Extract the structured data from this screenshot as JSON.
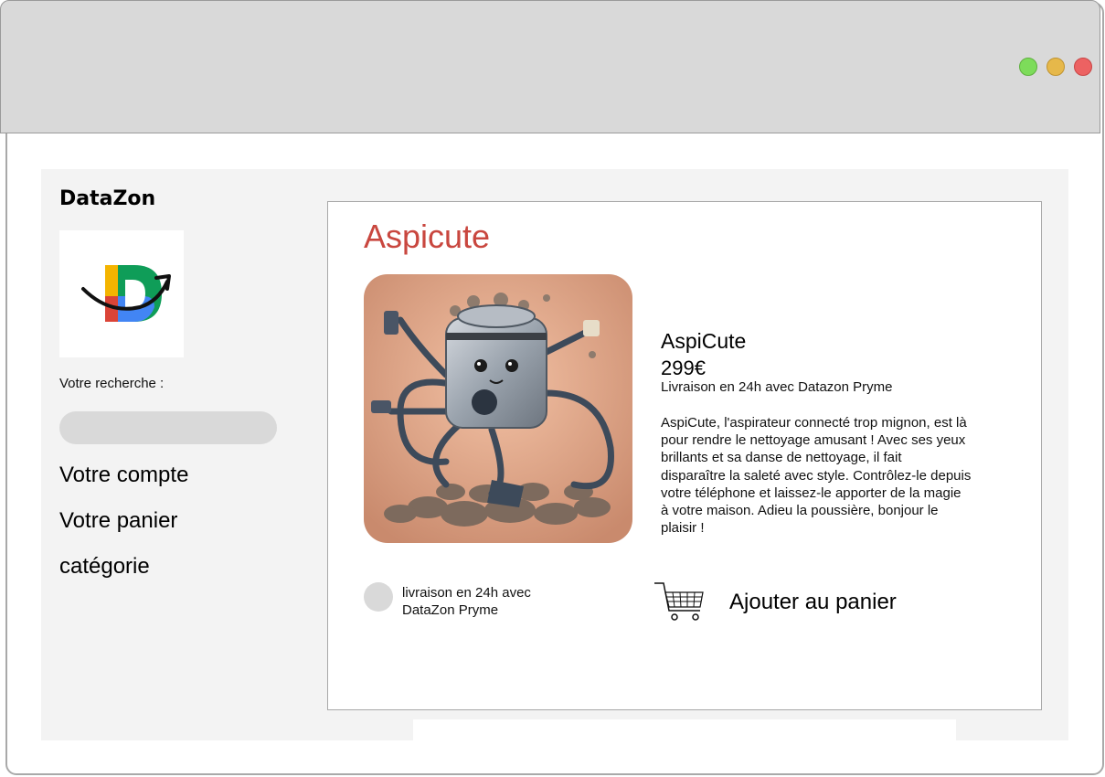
{
  "window": {
    "controls": [
      {
        "name": "maximize",
        "color": "#7ddc5a"
      },
      {
        "name": "minimize",
        "color": "#e6b84a"
      },
      {
        "name": "close",
        "color": "#ec6262"
      }
    ]
  },
  "sidebar": {
    "brand": "DataZon",
    "logo": "datazon-logo",
    "search": {
      "label": "Votre recherche :",
      "value": "",
      "placeholder": ""
    },
    "nav": [
      {
        "label": "Votre compte"
      },
      {
        "label": "Votre panier"
      },
      {
        "label": "catégorie"
      }
    ]
  },
  "product": {
    "heading": "Aspicute",
    "image": "robot-vacuum-illustration",
    "name": "AspiCute",
    "price": "299€",
    "delivery": "Livraison en 24h avec Datazon Pryme",
    "description": "AspiCute, l'aspirateur connecté trop mignon, est là\npour rendre le  nettoyage amusant ! Avec ses yeux\nbrillants et sa danse de nettoyage, il  fait\ndisparaître la saleté avec style. Contrôlez-le depuis\nvotre  téléphone et laissez-le apporter de la magie\nà votre maison.  Adieu la poussière, bonjour le\nplaisir !"
  },
  "options": {
    "delivery_label": "livraison en 24h avec DataZon Pryme",
    "cart_icon": "shopping-cart-icon",
    "add_to_cart": "Ajouter au panier"
  },
  "colors": {
    "accent": "#c9473f",
    "chrome": "#d9d9d9",
    "panel": "#f3f3f3"
  }
}
